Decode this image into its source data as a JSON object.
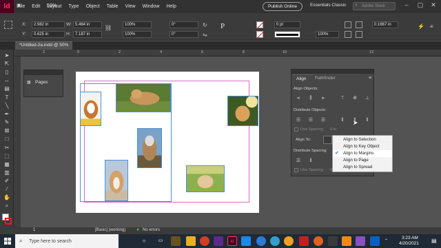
{
  "app": {
    "logo": "Id",
    "zoom": "50%"
  },
  "menu": [
    "File",
    "Edit",
    "Layout",
    "Type",
    "Object",
    "Table",
    "View",
    "Window",
    "Help"
  ],
  "header": {
    "publish_label": "Publish Online",
    "workspace": "Essentials Classic",
    "search_placeholder": "Adobe Stock"
  },
  "controls": {
    "x_label": "X:",
    "x_value": "2.982 in",
    "y_label": "Y:",
    "y_value": "0.625 in",
    "w_label": "W:",
    "w_value": "5.464 in",
    "h_label": "H:",
    "h_value": "7.187 in",
    "scale_x": "100%",
    "scale_y": "100%",
    "rotate": "0°",
    "shear": "0°",
    "stroke_weight": "0 pt",
    "percent": "100%",
    "offset": "0.1667 in"
  },
  "document": {
    "tab_title": "*Untitled-2a.indd @ 50%"
  },
  "ruler": [
    "2",
    "0",
    "2",
    "4",
    "6",
    "8",
    "10",
    "12"
  ],
  "pages_panel": {
    "title": "Pages"
  },
  "align_panel": {
    "tabs": [
      "Align",
      "Pathfinder"
    ],
    "align_objects": "Align Objects:",
    "distribute_objects": "Distribute Objects:",
    "use_spacing": "Use Spacing",
    "spacing_value": "0 in",
    "align_to": "Align To:",
    "distribute_spacing": "Distribute Spacing:",
    "use_spacing_2": "Use Spacing",
    "spacing_value_2": "0 in"
  },
  "align_to_menu": {
    "options": [
      "Align to Selection",
      "Align to Key Object",
      "Align to Margins",
      "Align to Page",
      "Align to Spread"
    ],
    "selected": "Align to Margins"
  },
  "status": {
    "page": "1",
    "style": "[Basic] (working)",
    "errors": "No errors"
  },
  "taskbar": {
    "search_placeholder": "Type here to search",
    "time": "3:23 AM",
    "date": "4/20/2021"
  },
  "colors": {
    "app_brand": "#ff3366",
    "selection": "#4a90d9",
    "margin": "#d36bd0",
    "accent": "#2f72c4"
  }
}
